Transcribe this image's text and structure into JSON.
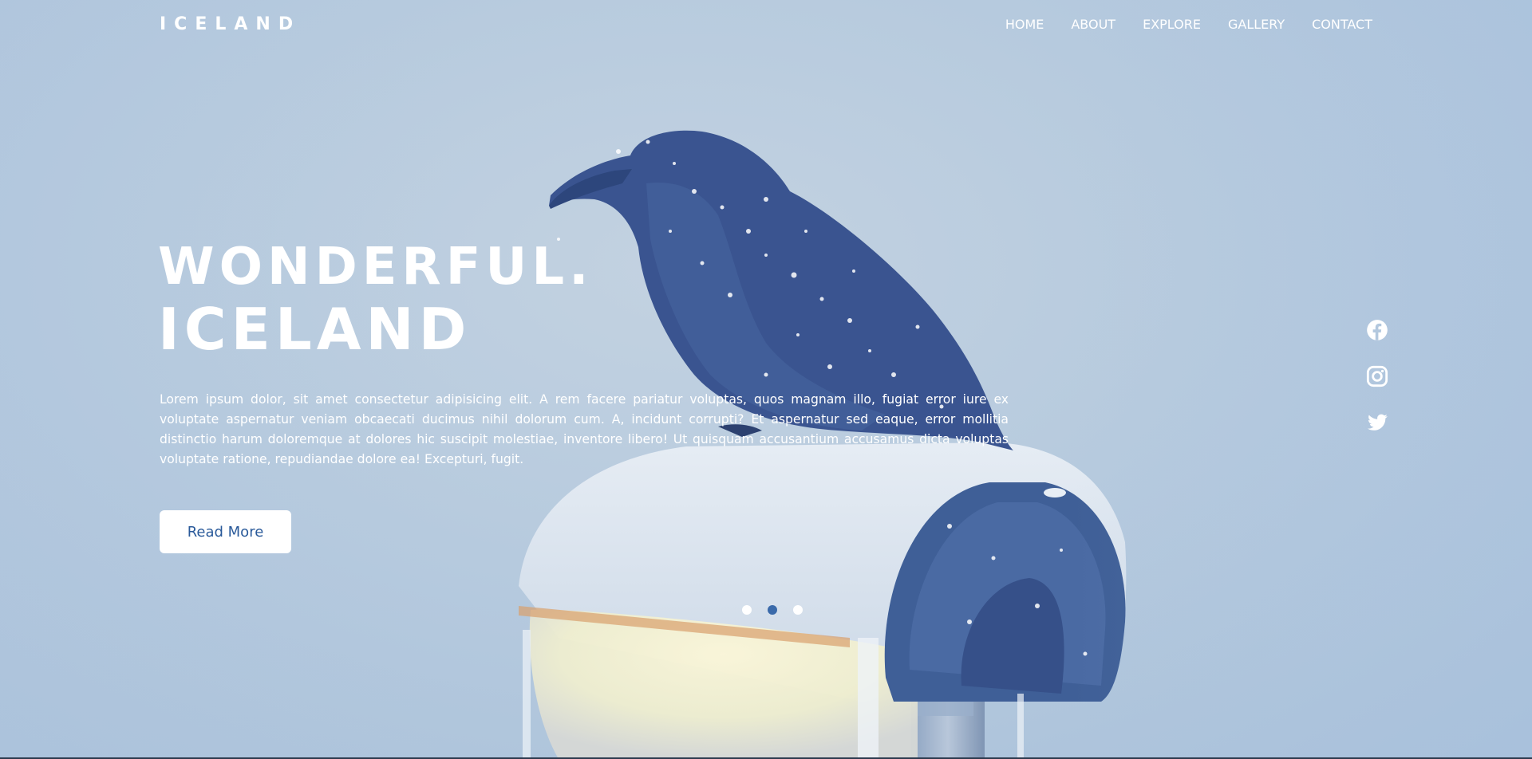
{
  "brand": {
    "logo": "ICELAND"
  },
  "nav": {
    "items": [
      "HOME",
      "ABOUT",
      "EXPLORE",
      "GALLERY",
      "CONTACT"
    ]
  },
  "hero": {
    "title_line1": "WONDERFUL.",
    "title_line2": "ICELAND",
    "body": "Lorem ipsum dolor, sit amet consectetur adipisicing elit. A rem facere pariatur voluptas, quos magnam illo, fugiat error iure ex voluptate aspernatur veniam obcaecati ducimus nihil dolorum cum. A, incidunt corrupti? Et aspernatur sed eaque, error mollitia distinctio harum doloremque at dolores hic suscipit molestiae, inventore libero! Ut quisquam accusantium accusamus dicta voluptas voluptate ratione, repudiandae dolore ea! Excepturi, fugit.",
    "cta_label": "Read More"
  },
  "social": {
    "icons": [
      "facebook-icon",
      "instagram-icon",
      "twitter-icon"
    ]
  },
  "carousel": {
    "slide_count": 3,
    "active_index": 1
  },
  "colors": {
    "background": "#b6cade",
    "accent": "#3a6aaa",
    "text": "#ffffff",
    "button_text": "#2a5a9a"
  }
}
